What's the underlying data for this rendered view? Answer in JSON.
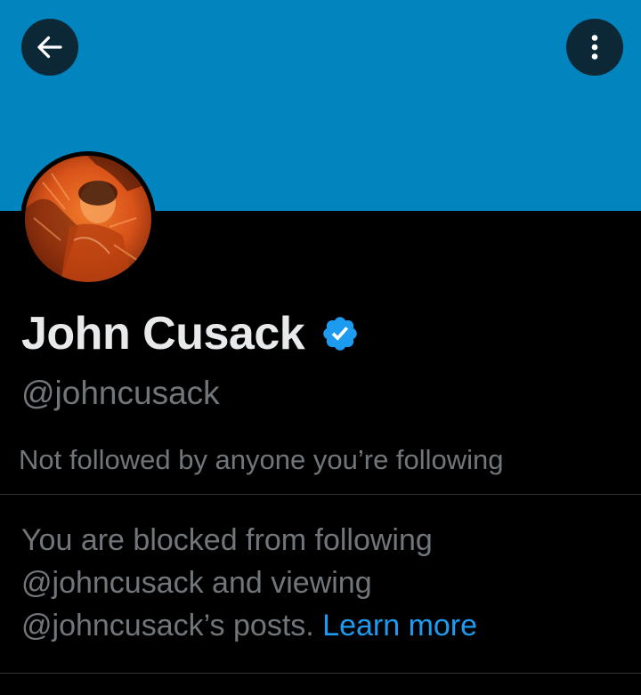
{
  "colors": {
    "banner": "#0285BE",
    "background": "#000000",
    "name": "#E7E9EA",
    "secondary_text": "#71767B",
    "link": "#1D9BF0",
    "verified_badge": "#1D9BF0",
    "divider": "#2F3336"
  },
  "header": {
    "back_icon": "arrow-left-icon",
    "more_icon": "more-vertical-icon"
  },
  "profile": {
    "display_name": "John Cusack",
    "verified_icon": "verified-badge-icon",
    "handle": "@johncusack",
    "mutual_followers": "Not followed by anyone you’re following"
  },
  "blocked_notice": {
    "line1": "You are blocked from following",
    "line2": "@johncusack and viewing",
    "line3": "@johncusack’s posts.",
    "link": "Learn more"
  }
}
